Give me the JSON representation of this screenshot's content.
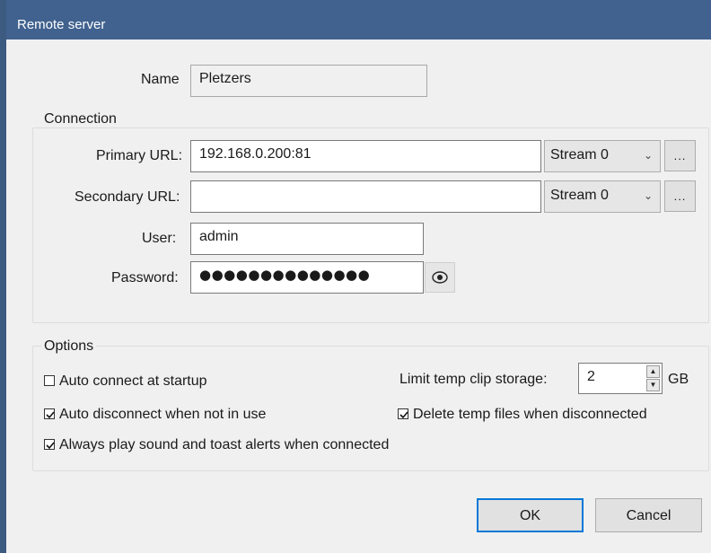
{
  "window": {
    "title": "Remote server"
  },
  "name_field": {
    "label": "Name",
    "value": "Pletzers"
  },
  "connection": {
    "group_title": "Connection",
    "primary_url": {
      "label": "Primary URL:",
      "value": "192.168.0.200:81",
      "stream": "Stream 0",
      "browse_label": "..."
    },
    "secondary_url": {
      "label": "Secondary URL:",
      "value": "",
      "stream": "Stream 0",
      "browse_label": "..."
    },
    "user": {
      "label": "User:",
      "value": "admin"
    },
    "password": {
      "label": "Password:",
      "value": "●●●●●●●●●●●●●●"
    },
    "show_password_icon": "eye-icon"
  },
  "options": {
    "group_title": "Options",
    "auto_connect": {
      "label": "Auto connect at startup",
      "checked": false
    },
    "auto_disconnect": {
      "label": "Auto disconnect when not in use",
      "checked": true
    },
    "always_play_sound": {
      "label": "Always play sound and toast alerts when connected",
      "checked": true
    },
    "limit_temp": {
      "label": "Limit temp clip storage:",
      "value": "2",
      "unit": "GB"
    },
    "delete_temp": {
      "label": "Delete temp files when disconnected",
      "checked": true
    }
  },
  "buttons": {
    "ok": "OK",
    "cancel": "Cancel"
  },
  "colors": {
    "titlebar": "#41628f",
    "window_bg": "#f0f0f0",
    "focus_accent": "#0078d7"
  }
}
